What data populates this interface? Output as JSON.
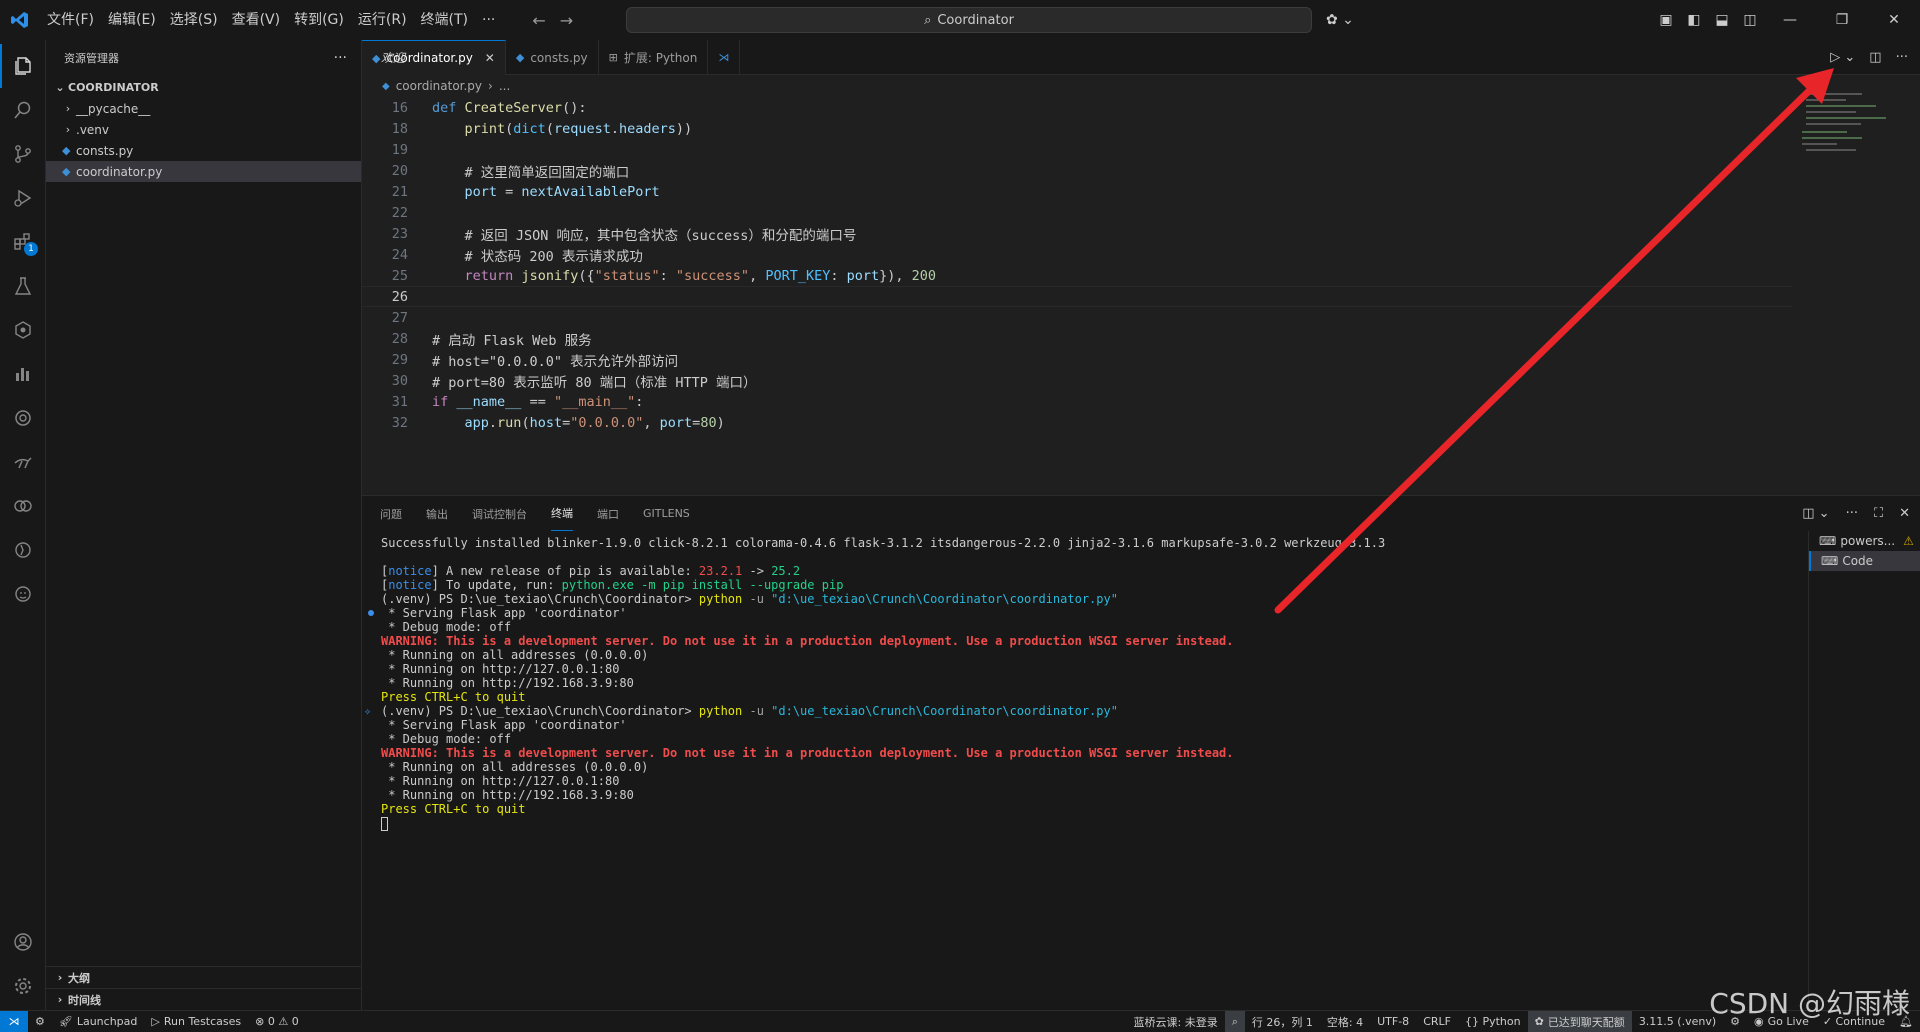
{
  "titlebar": {
    "menu": [
      "文件(F)",
      "编辑(E)",
      "选择(S)",
      "查看(V)",
      "转到(G)",
      "运行(R)",
      "终端(T)",
      "···"
    ],
    "search_text": "Coordinator"
  },
  "activitybar": {
    "icons": [
      "explorer-icon",
      "search-icon",
      "source-control-icon",
      "run-debug-icon",
      "extensions-icon",
      "testing-icon",
      "gitlens-icon",
      "chart-icon",
      "remote-icon",
      "kangaroo-icon",
      "live-share-icon",
      "timeline-icon",
      "copilot-icon"
    ],
    "extensions_badge": "1"
  },
  "sidebar": {
    "title": "资源管理器",
    "folder": "COORDINATOR",
    "items": [
      {
        "label": "__pycache__",
        "type": "folder"
      },
      {
        "label": ".venv",
        "type": "folder"
      },
      {
        "label": "consts.py",
        "type": "py"
      },
      {
        "label": "coordinator.py",
        "type": "py",
        "selected": true
      }
    ],
    "outline": "大纲",
    "timeline": "时间线"
  },
  "tabs": [
    {
      "label": "coordinator.py",
      "active": true
    },
    {
      "label": "consts.py",
      "active": false
    },
    {
      "label": "扩展: Python",
      "active": false
    },
    {
      "label": "欢迎",
      "active": false
    }
  ],
  "breadcrumb": [
    "coordinator.py",
    "..."
  ],
  "code": {
    "lines": [
      {
        "n": "16",
        "html": "def CreateServer():"
      },
      {
        "n": "18",
        "html": "print(dict(request.headers))"
      },
      {
        "n": "19",
        "html": ""
      },
      {
        "n": "20",
        "html": "# 这里简单返回固定的端口"
      },
      {
        "n": "21",
        "html": "port = nextAvailablePort"
      },
      {
        "n": "22",
        "html": ""
      },
      {
        "n": "23",
        "html": "# 返回 JSON 响应，其中包含状态（success）和分配的端口号"
      },
      {
        "n": "24",
        "html": "# 状态码 200 表示请求成功"
      },
      {
        "n": "25",
        "html": "return jsonify({\"status\": \"success\", PORT_KEY: port}), 200"
      },
      {
        "n": "26",
        "html": ""
      },
      {
        "n": "27",
        "html": ""
      },
      {
        "n": "28",
        "html": "# 启动 Flask Web 服务"
      },
      {
        "n": "29",
        "html": "# host=\"0.0.0.0\" 表示允许外部访问"
      },
      {
        "n": "30",
        "html": "# port=80 表示监听 80 端口（标准 HTTP 端口）"
      },
      {
        "n": "31",
        "html": "if __name__ == \"__main__\":"
      },
      {
        "n": "32",
        "html": "app.run(host=\"0.0.0.0\", port=80)"
      }
    ]
  },
  "panel": {
    "tabs": [
      "问题",
      "输出",
      "调试控制台",
      "终端",
      "端口",
      "GITLENS"
    ],
    "active_tab": "终端",
    "terminal_list": [
      "powers...",
      "Code"
    ]
  },
  "terminal": {
    "installed": "Successfully installed blinker-1.9.0 click-8.2.1 colorama-0.4.6 flask-3.1.2 itsdangerous-2.2.0 jinja2-3.1.6 markupsafe-3.0.2 werkzeug-3.1.3",
    "notice_tag": "notice",
    "notice1_a": " A new release of pip is available: ",
    "notice1_old": "23.2.1",
    "notice1_arrow": " -> ",
    "notice1_new": "25.2",
    "notice2_a": " To update, run: ",
    "notice2_cmd": "python.exe -m pip install --upgrade pip",
    "prompt": "(.venv) PS D:\\ue_texiao\\Crunch\\Coordinator> ",
    "cmd": "python",
    "cmd_flag": " -u ",
    "cmd_path": "\"d:\\ue_texiao\\Crunch\\Coordinator\\coordinator.py\"",
    "serving": " * Serving Flask app 'coordinator'",
    "debug": " * Debug mode: off",
    "warning_label": "WARNING: This is a development server. Do not use it in a production deployment. Use a production WSGI server instead.",
    "running_all": " * Running on all addresses (0.0.0.0)",
    "running_local": " * Running on http://127.0.0.1:80",
    "running_lan": " * Running on http://192.168.3.9:80",
    "quit": "Press CTRL+C to quit"
  },
  "statusbar": {
    "left": [
      "Launchpad",
      "Run Testcases",
      "⊗ 0 ⚠ 0"
    ],
    "right": [
      "蓝桥云课: 未登录",
      "行 26，列 1",
      "空格: 4",
      "UTF-8",
      "CRLF",
      "{} Python",
      "已达到聊天配额",
      "3.11.5 (.venv)",
      "Go Live",
      "✓ Continue"
    ]
  },
  "watermark": "CSDN @幻雨様",
  "colors": {
    "accent": "#0078d4",
    "arrow": "#e8262a",
    "background": "#1f1f1f"
  }
}
